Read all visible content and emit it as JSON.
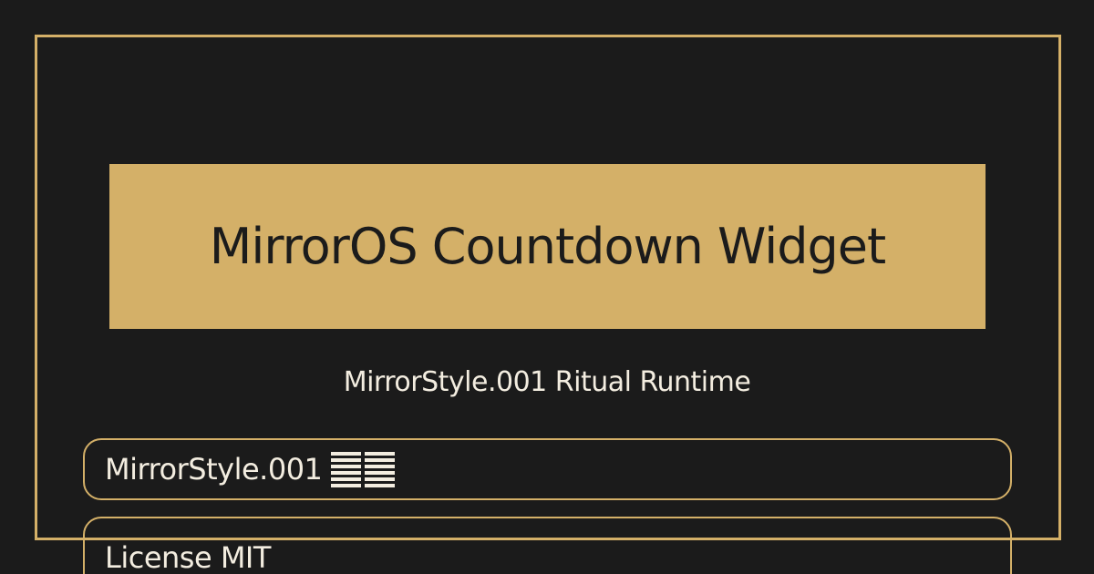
{
  "card": {
    "title": "MirrorOS Countdown Widget",
    "subtitle": "MirrorStyle.001 Ritual Runtime",
    "badges": [
      {
        "label": "MirrorStyle.001",
        "icon": "hexagram-bars-icon"
      },
      {
        "label": "License MIT"
      }
    ]
  },
  "colors": {
    "background": "#1b1b1b",
    "accent": "#d4b068",
    "text_light": "#f3ede0",
    "text_dark": "#1b1b1b"
  }
}
